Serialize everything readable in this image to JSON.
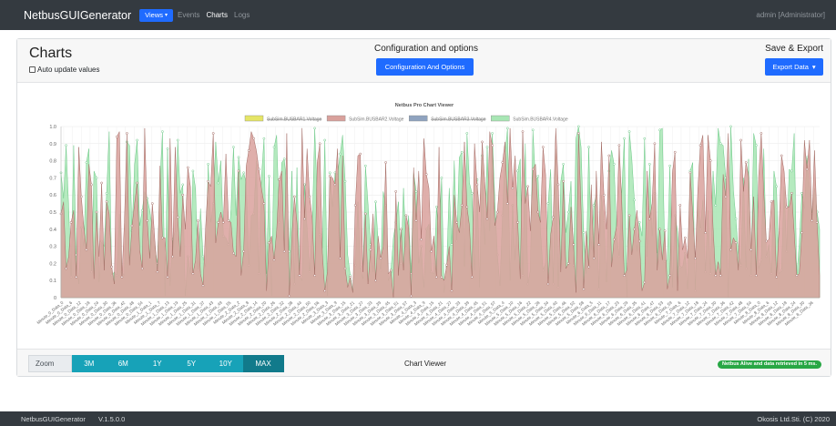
{
  "navbar": {
    "brand": "NetbusGUIGenerator",
    "views_label": "Views",
    "links": [
      "Events",
      "Charts",
      "Logs"
    ],
    "active_link": "Charts",
    "user": "admin [Administrator]"
  },
  "header": {
    "title": "Charts",
    "auto_update_label": "Auto update values",
    "config_title": "Configuration and options",
    "config_button": "Configuration And Options",
    "export_title": "Save & Export",
    "export_button": "Export Data"
  },
  "chart_data": {
    "type": "area",
    "title": "Netbus Pro Chart Viewer",
    "xlabel": "",
    "ylabel": "",
    "ylim": [
      0,
      1.0
    ],
    "yticks": [
      "0",
      "0.1",
      "0.2",
      "0.3",
      "0.4",
      "0.5",
      "0.6",
      "0.7",
      "0.8",
      "0.9",
      "1.0"
    ],
    "grid": true,
    "legend_position": "top",
    "series": [
      {
        "name": "SubSim.BUSBAR1.Voltage",
        "color": "#e5e566",
        "hidden": true
      },
      {
        "name": "SubSim.BUSBAR2.Voltage",
        "color": "#d9a19c",
        "hidden": false,
        "seed": 7
      },
      {
        "name": "SubSim.BUSBAR3.Voltage",
        "color": "#8fa3bf",
        "hidden": true
      },
      {
        "name": "SubSim.BUSBAR4.Voltage",
        "color": "#a8e6b4",
        "hidden": false,
        "seed": 13
      }
    ],
    "x_label_samples": [
      "Minute_0_Data_0",
      "Minute_0_Data_6",
      "Minute_0_Data_12",
      "Minute_0_Data_18",
      "Minute_0_Data_24",
      "Minute_0_Data_30",
      "Minute_0_Data_36",
      "Minute_0_Data_42",
      "Minute_0_Data_48",
      "Minute_0_Data_54",
      "Minute_1_Data_1",
      "Minute_1_Data_7",
      "Minute_1_Data_13",
      "Minute_1_Data_19",
      "Minute_1_Data_25",
      "Minute_1_Data_31",
      "Minute_1_Data_37",
      "Minute_1_Data_43",
      "Minute_1_Data_49",
      "Minute_1_Data_55",
      "Minute_2_Data_2",
      "Minute_2_Data_8",
      "Minute_2_Data_14",
      "Minute_2_Data_20",
      "Minute_2_Data_26",
      "Minute_2_Data_32",
      "Minute_2_Data_38",
      "Minute_2_Data_44",
      "Minute_2_Data_50",
      "Minute_2_Data_56",
      "Minute_3_Data_3",
      "Minute_3_Data_9",
      "Minute_3_Data_15",
      "Minute_3_Data_21",
      "Minute_3_Data_27",
      "Minute_3_Data_33",
      "Minute_3_Data_39",
      "Minute_3_Data_45",
      "Minute_3_Data_51",
      "Minute_3_Data_57",
      "Minute_4_Data_3",
      "Minute_4_Data_9",
      "Minute_4_Data_15",
      "Minute_4_Data_21",
      "Minute_4_Data_27",
      "Minute_4_Data_33",
      "Minute_4_Data_39",
      "Minute_4_Data_45",
      "Minute_4_Data_51",
      "Minute_4_Data_57",
      "Minute_5_Data_4",
      "Minute_5_Data_10",
      "Minute_5_Data_16",
      "Minute_5_Data_22",
      "Minute_5_Data_28",
      "Minute_5_Data_34",
      "Minute_5_Data_40",
      "Minute_5_Data_46",
      "Minute_5_Data_52",
      "Minute_5_Data_58",
      "Minute_6_Data_5",
      "Minute_6_Data_11",
      "Minute_6_Data_17",
      "Minute_6_Data_23",
      "Minute_6_Data_29",
      "Minute_6_Data_35",
      "Minute_6_Data_41",
      "Minute_6_Data_47",
      "Minute_6_Data_53",
      "Minute_6_Data_59",
      "Minute_7_Data_6",
      "Minute_7_Data_12",
      "Minute_7_Data_18",
      "Minute_7_Data_24",
      "Minute_7_Data_30",
      "Minute_7_Data_36",
      "Minute_7_Data_42",
      "Minute_7_Data_48",
      "Minute_7_Data_54",
      "Minute_8_Data_0",
      "Minute_8_Data_6",
      "Minute_8_Data_12",
      "Minute_8_Data_18",
      "Minute_8_Data_24",
      "Minute_8_Data_30",
      "Minute_8_Data_36"
    ],
    "points_per_series": 300
  },
  "footer_bar": {
    "zoom_label": "Zoom",
    "zoom_options": [
      "3M",
      "6M",
      "1Y",
      "5Y",
      "10Y",
      "MAX"
    ],
    "active_zoom": "MAX",
    "viewer_label": "Chart Viewer",
    "status": "Netbus Alive and data retrieved in 5 ms."
  },
  "page_footer": {
    "app": "NetbusGUIGenerator",
    "version": "V.1.5.0.0",
    "copyright": "Okosis Ltd.Sti. (C) 2020"
  }
}
